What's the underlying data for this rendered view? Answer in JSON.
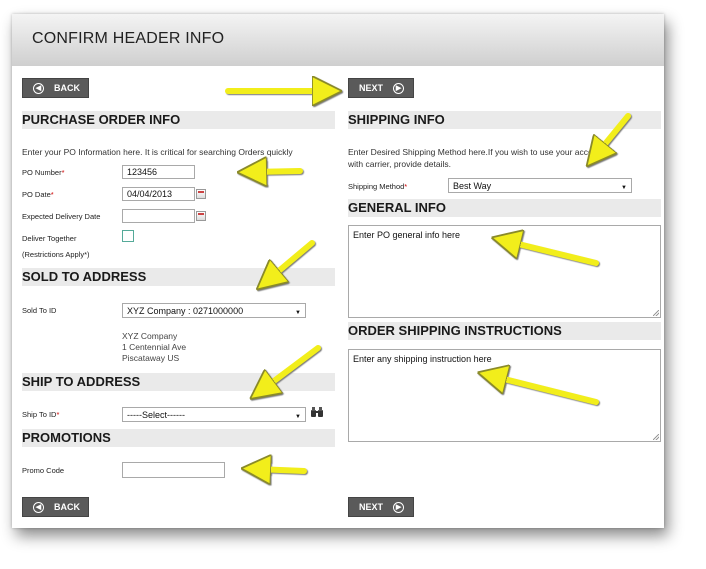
{
  "title": "CONFIRM HEADER INFO",
  "buttons": {
    "back": "BACK",
    "next": "NEXT"
  },
  "po": {
    "section": "PURCHASE ORDER INFO",
    "intro": "Enter your PO Information here. It is critical for searching Orders quickly",
    "po_number_label": "PO Number",
    "po_number_value": "123456",
    "po_date_label": "PO Date",
    "po_date_value": "04/04/2013",
    "expected_label": "Expected Delivery Date",
    "expected_value": "",
    "deliver_together_label": "Deliver Together",
    "restrictions_label": "(Restrictions Apply*)"
  },
  "sold_to": {
    "section": "SOLD TO ADDRESS",
    "id_label": "Sold To ID",
    "id_value": "XYZ Company : 0271000000",
    "addr_line1": "XYZ Company",
    "addr_line2": "1 Centennial Ave",
    "addr_line3": "Piscataway US"
  },
  "ship_to": {
    "section": "SHIP TO ADDRESS",
    "id_label": "Ship To ID",
    "id_value": "-----Select------"
  },
  "promotions": {
    "section": "PROMOTIONS",
    "code_label": "Promo Code",
    "code_value": ""
  },
  "shipping": {
    "section": "SHIPPING INFO",
    "intro_line1": "Enter Desired Shipping Method here.If you wish to use your account",
    "intro_line2": "with carrier, provide details.",
    "method_label": "Shipping Method",
    "method_value": "Best Way"
  },
  "general": {
    "section": "GENERAL INFO",
    "text": "Enter PO general info here"
  },
  "order_shipping": {
    "section": "ORDER SHIPPING INSTRUCTIONS",
    "text": "Enter any shipping instruction here"
  },
  "required_mark": "*",
  "colors": {
    "arrow": "#f2ee1b",
    "button": "#5a5a5a",
    "section_bg": "#eaeaea",
    "required": "#cc0000"
  },
  "icons": [
    "circle-left-icon",
    "circle-right-icon",
    "calendar-icon",
    "binoculars-icon",
    "callout-arrow-icon"
  ]
}
